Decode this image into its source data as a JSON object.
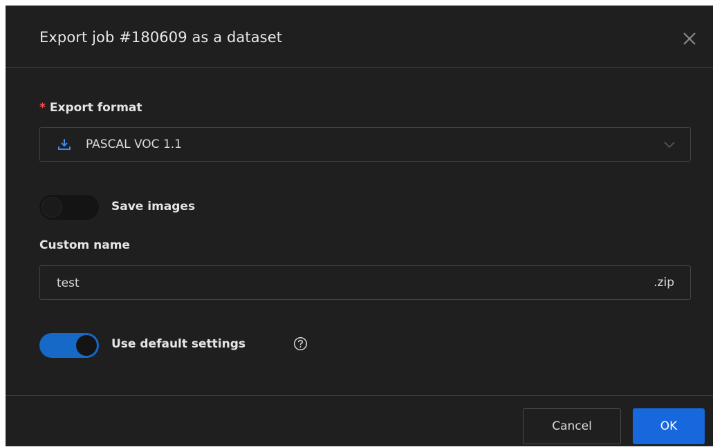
{
  "dialog": {
    "title": "Export job #180609 as a dataset"
  },
  "export_format": {
    "required_mark": "*",
    "label": "Export format",
    "selected": "PASCAL VOC 1.1",
    "icon": "download-icon"
  },
  "save_images": {
    "label": "Save images",
    "enabled": false
  },
  "custom_name": {
    "label": "Custom name",
    "value": "test",
    "suffix": ".zip"
  },
  "default_settings": {
    "label": "Use default settings",
    "enabled": true,
    "help_icon": "question-circle-icon"
  },
  "footer": {
    "cancel_label": "Cancel",
    "ok_label": "OK"
  },
  "colors": {
    "background": "#1f1f1f",
    "accent": "#1668dc",
    "required": "#ff4d4f",
    "border": "#424242"
  }
}
